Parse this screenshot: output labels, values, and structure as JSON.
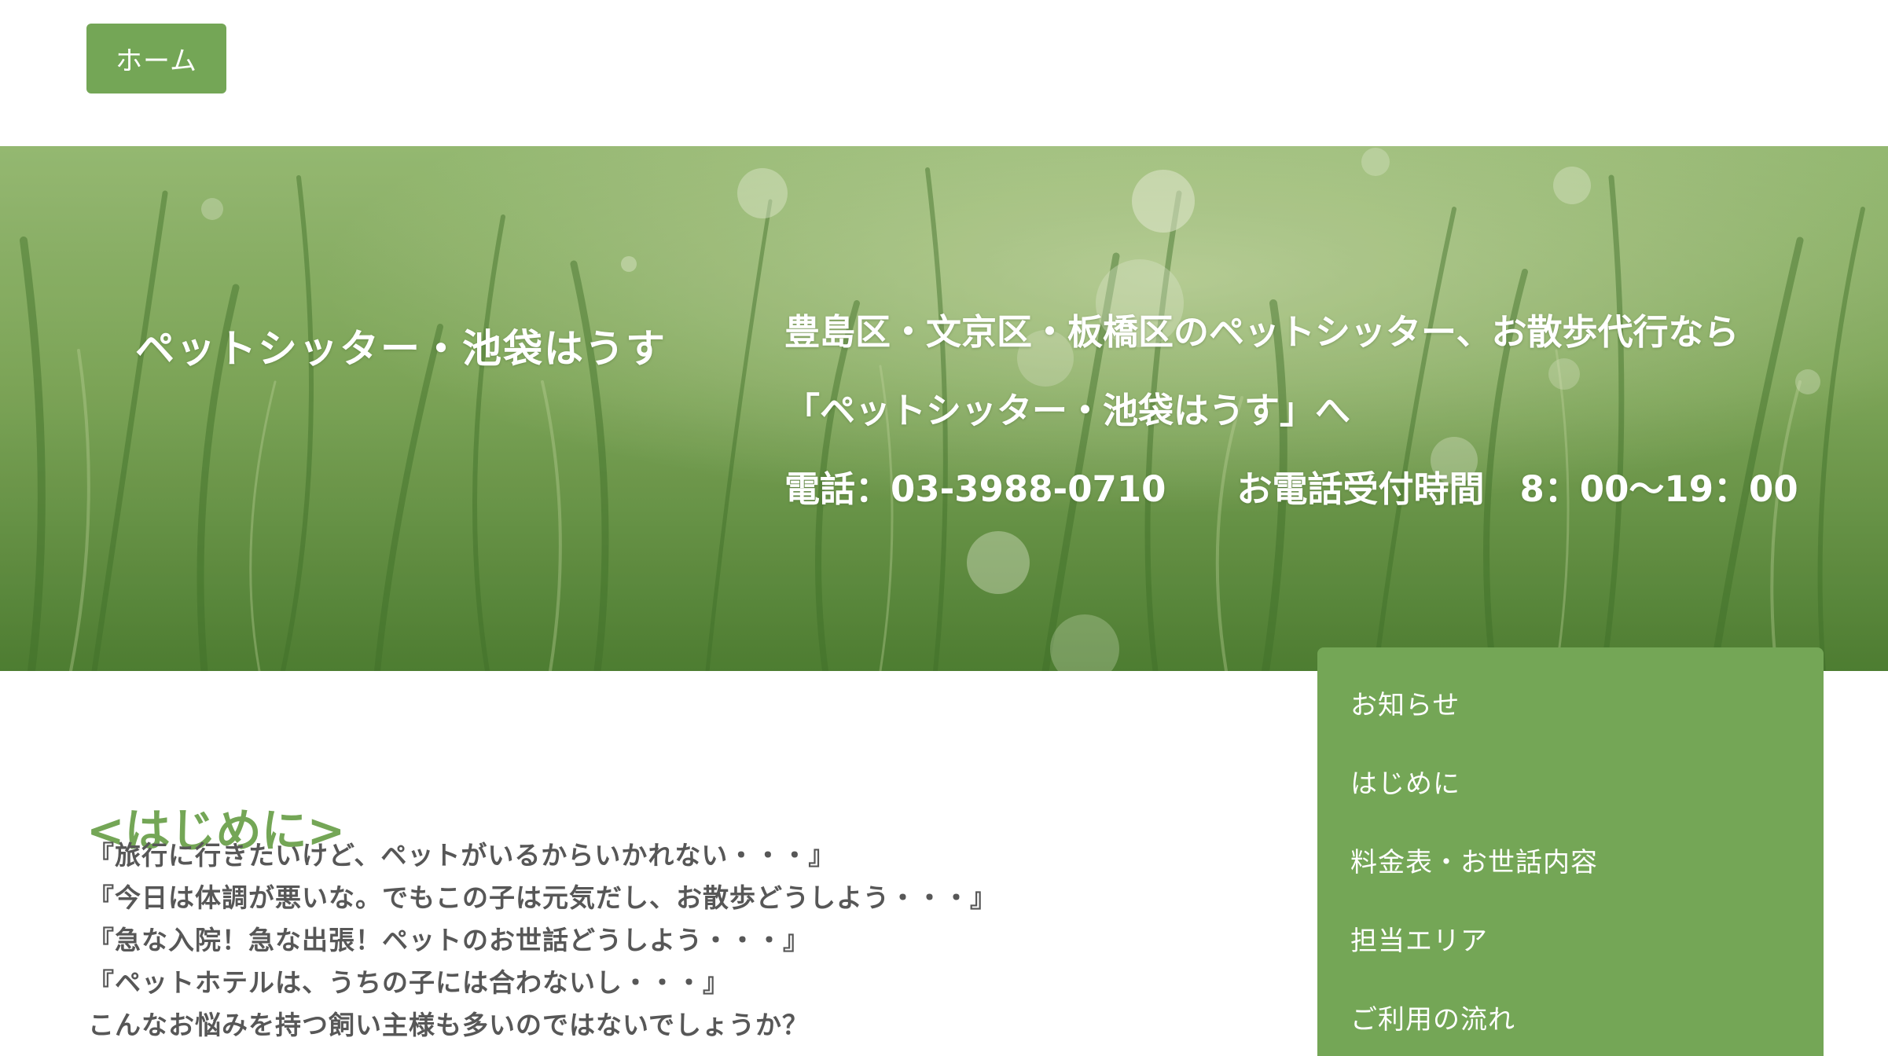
{
  "header": {
    "home_label": "ホーム"
  },
  "hero": {
    "title": "ペットシッター・池袋はうす",
    "line1": "豊島区・文京区・板橋区のペットシッター、お散歩代行なら",
    "line2": "「ペットシッター・池袋はうす」へ",
    "phone": "電話：03-3988-0710",
    "hours": "お電話受付時間　8：00〜19：00"
  },
  "main": {
    "section_title": "<はじめに>",
    "intro_lines": [
      "『旅行に行きたいけど、ペットがいるからいかれない・・・』",
      "『今日は体調が悪いな。でもこの子は元気だし、お散歩どうしよう・・・』",
      "『急な入院！急な出張！ペットのお世話どうしよう・・・』",
      "『ペットホテルは、うちの子には合わないし・・・』",
      "こんなお悩みを持つ飼い主様も多いのではないでしょうか？"
    ]
  },
  "sidebar": {
    "items": [
      {
        "label": "お知らせ"
      },
      {
        "label": "はじめに"
      },
      {
        "label": "料金表・お世話内容"
      },
      {
        "label": "担当エリア"
      },
      {
        "label": "ご利用の流れ"
      }
    ]
  },
  "colors": {
    "accent": "#74a656",
    "text": "#555555",
    "hero_text": "#ffffff"
  }
}
